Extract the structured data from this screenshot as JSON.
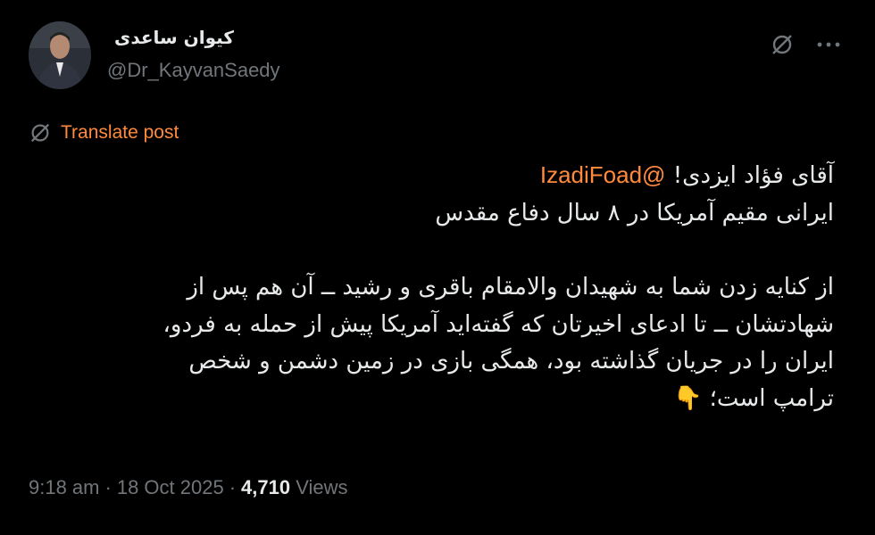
{
  "author": {
    "name": "کیوان ساعدی",
    "handle": "@Dr_KayvanSaedy",
    "avatar_icon": "user-avatar-photo"
  },
  "actions": {
    "grok_icon": "grok-icon",
    "more_icon": "more-options-icon"
  },
  "translate": {
    "label": "Translate post",
    "icon": "translate-globe-icon"
  },
  "tweet": {
    "line1_text": "آقای فؤاد ایزدی!",
    "line1_mention": "@IzadiFoad",
    "line2": "ایرانی مقیم آمریکا در ۸ سال دفاع مقدس",
    "paragraph2_line1": "از کنایه زدن شما به شهیدان والامقام باقری و رشید ــ آن هم پس از",
    "paragraph2_line2": "شهادتشان ــ تا ادعای اخیرتان که گفته‌اید آمریکا پیش از حمله به فردو،",
    "paragraph2_line3": "ایران را در جریان گذاشته بود، همگی بازی در زمین دشمن و شخص",
    "paragraph2_line4": "ترامپ است؛",
    "emoji": "👇"
  },
  "meta": {
    "time": "9:18 am",
    "date": "18 Oct 2025",
    "views_count": "4,710",
    "views_label": "Views",
    "separator": "·"
  },
  "colors": {
    "background": "#000000",
    "text": "#e7e9ea",
    "muted": "#71767b",
    "accent": "#ff8a3d"
  }
}
